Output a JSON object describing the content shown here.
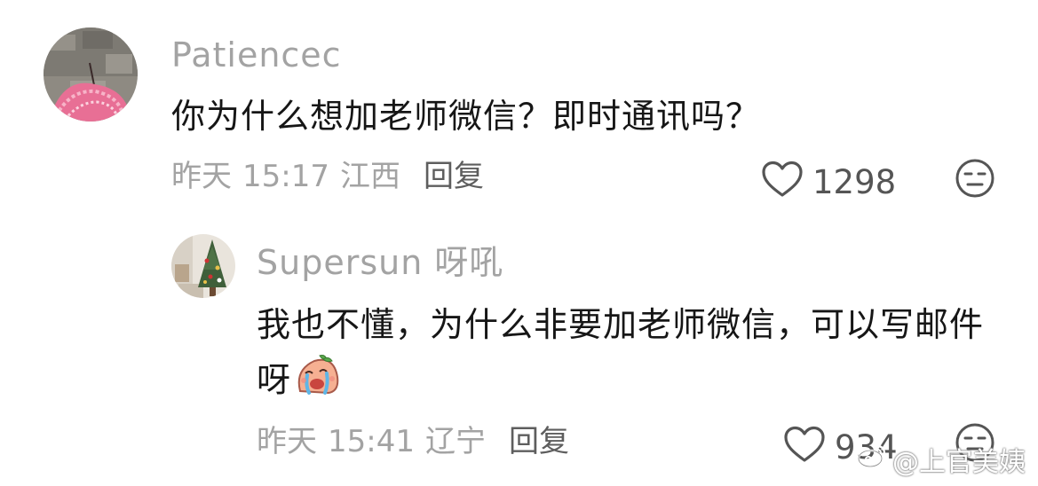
{
  "comments": [
    {
      "username": "Patiencec",
      "text": "你为什么想加老师微信？即时通讯吗？",
      "date": "昨天",
      "time": "15:17",
      "location": "江西",
      "reply_label": "回复",
      "likes": "1298",
      "avatar_icon": "pink-umbrella-photo-avatar",
      "like_icon": "heart-outline-icon",
      "dislike_icon": "meh-face-icon"
    },
    {
      "username": "Supersun 呀吼",
      "text": "我也不懂，为什么非要加老师微信，可以写邮件呀",
      "emoji": "crying-face-emoji",
      "date": "昨天",
      "time": "15:41",
      "location": "辽宁",
      "reply_label": "回复",
      "likes": "934",
      "avatar_icon": "christmas-tree-photo-avatar",
      "like_icon": "heart-outline-icon",
      "dislike_icon": "meh-face-icon"
    }
  ],
  "watermark": {
    "text": "@上官美姨",
    "icon": "weibo-logo-icon"
  },
  "colors": {
    "text_primary": "#161616",
    "text_secondary": "#a3a3a3",
    "reply": "#5e5e5e",
    "icon": "#555555"
  }
}
